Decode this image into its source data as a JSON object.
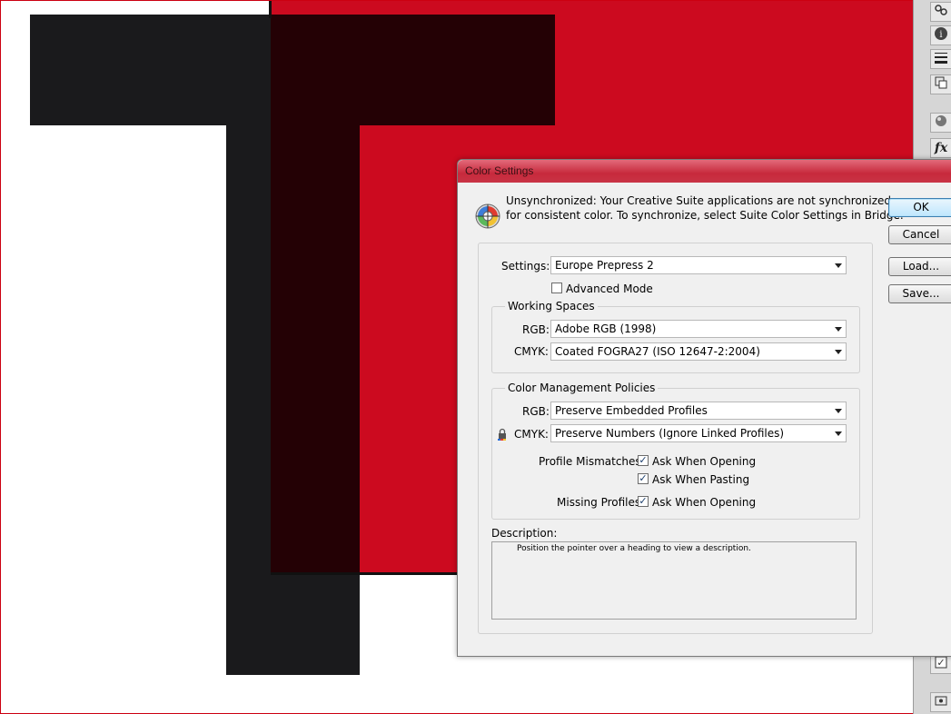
{
  "dialog": {
    "title": "Color Settings",
    "sync_message_line1": "Unsynchronized: Your Creative Suite applications are not synchronized",
    "sync_message_line2": "for consistent color. To synchronize, select Suite Color Settings in Bridge.",
    "settings_label": "Settings:",
    "settings_value": "Europe Prepress 2",
    "advanced_mode_label": "Advanced Mode",
    "advanced_mode_checked": false,
    "working_spaces": {
      "title": "Working Spaces",
      "rgb_label": "RGB:",
      "rgb_value": "Adobe RGB (1998)",
      "cmyk_label": "CMYK:",
      "cmyk_value": "Coated FOGRA27 (ISO 12647-2:2004)"
    },
    "policies": {
      "title": "Color Management Policies",
      "rgb_label": "RGB:",
      "rgb_value": "Preserve Embedded Profiles",
      "cmyk_label": "CMYK:",
      "cmyk_value": "Preserve Numbers (Ignore Linked Profiles)",
      "profile_mismatches_label": "Profile Mismatches:",
      "ask_when_opening_label": "Ask When Opening",
      "ask_when_pasting_label": "Ask When Pasting",
      "missing_profiles_label": "Missing Profiles:",
      "missing_ask_when_opening_label": "Ask When Opening",
      "check_mark": "✓"
    },
    "description_label": "Description:",
    "description_text": "Position the pointer over a heading to view a description.",
    "buttons": {
      "ok": "OK",
      "cancel": "Cancel",
      "load": "Load...",
      "save": "Save..."
    }
  },
  "colors": {
    "artwork_red": "#cc0a1f",
    "artwork_black": "#1a1a1c",
    "artwork_overlap": "#240105",
    "title_bar": "#c7293c"
  },
  "panel_icons": [
    "link-icon",
    "info-icon",
    "stroke-icon",
    "transform-icon",
    "swatches-icon",
    "effects-icon",
    "checkbox-icon",
    "layers-icon"
  ],
  "panel_glyphs": {
    "fx": "fx",
    "info": "i",
    "check": "✓"
  }
}
